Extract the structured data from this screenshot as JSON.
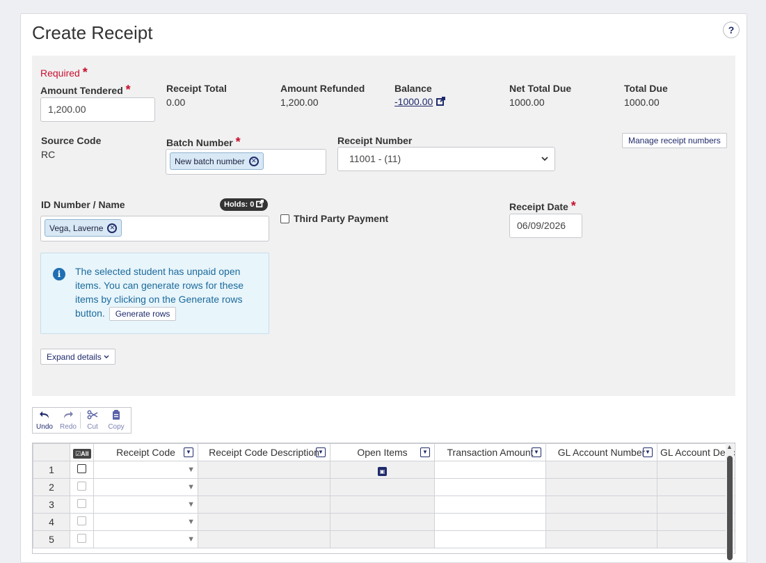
{
  "page": {
    "title": "Create Receipt",
    "help_label": "?"
  },
  "form": {
    "required_label": "Required",
    "required_star": "*",
    "amount_tendered": {
      "label": "Amount Tendered",
      "value": "1,200.00"
    },
    "summary": {
      "receipt_total": {
        "label": "Receipt Total",
        "value": "0.00"
      },
      "amount_refunded": {
        "label": "Amount Refunded",
        "value": "1,200.00"
      },
      "balance": {
        "label": "Balance",
        "value": "-1000.00"
      },
      "net_total_due": {
        "label": "Net Total Due",
        "value": "1000.00"
      },
      "total_due": {
        "label": "Total Due",
        "value": "1000.00"
      }
    },
    "source_code": {
      "label": "Source Code",
      "value": "RC"
    },
    "batch_number": {
      "label": "Batch Number",
      "tag": "New batch number"
    },
    "receipt_number": {
      "label": "Receipt Number",
      "selected": "11001 - (11)"
    },
    "manage_receipt_numbers_label": "Manage receipt numbers",
    "id_number": {
      "label": "ID Number / Name",
      "holds_label": "Holds: 0",
      "tag": "Vega, Laverne"
    },
    "third_party_label": "Third Party Payment",
    "receipt_date": {
      "label": "Receipt Date",
      "value": "06/09/2026"
    },
    "info_message": "The selected student has unpaid open items. You can generate rows for these items by clicking on the Generate rows button.",
    "generate_rows_label": "Generate rows",
    "expand_details_label": "Expand details"
  },
  "toolbar": {
    "undo": "Undo",
    "redo": "Redo",
    "cut": "Cut",
    "copy": "Copy"
  },
  "grid": {
    "all_label": "All",
    "columns": [
      "Receipt Code",
      "Receipt Code Description",
      "Open Items",
      "Transaction Amount",
      "GL Account Number",
      "GL Account Description"
    ],
    "rows": [
      "1",
      "2",
      "3",
      "4",
      "5"
    ]
  },
  "colors": {
    "accent": "#1f2a6b",
    "required": "#c8102e",
    "info_text": "#1b6a9c",
    "info_bg": "#e8f5fb",
    "panel_bg": "#f1f1f2"
  }
}
